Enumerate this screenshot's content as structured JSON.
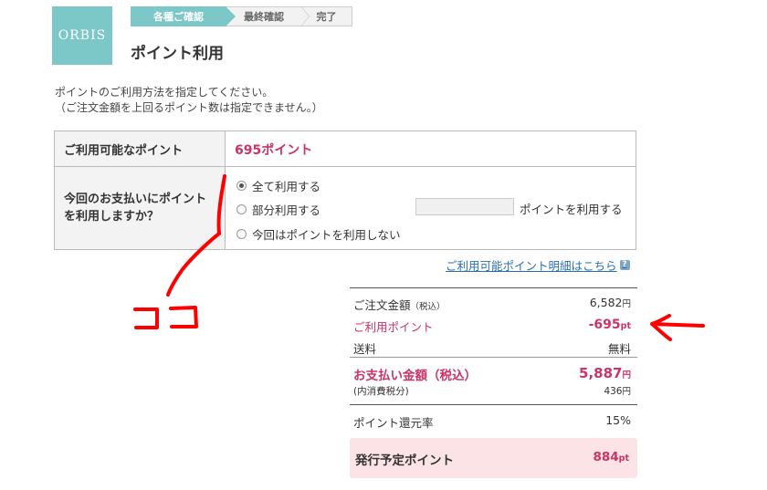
{
  "logo": {
    "text": "ORBIS"
  },
  "steps": [
    "各種ご確認",
    "最終確認",
    "完了"
  ],
  "page_title": "ポイント利用",
  "intro": {
    "line1": "ポイントのご利用方法を指定してください。",
    "line2": "（ご注文金額を上回るポイント数は指定できません。）"
  },
  "points_table": {
    "available_label": "ご利用可能なポイント",
    "available_value": "695ポイント",
    "question_line1": "今回のお支払いにポイント",
    "question_line2": "を利用しますか？",
    "options": [
      "全て利用する",
      "部分利用する",
      "今回はポイントを利用しない"
    ],
    "selected_index": 0,
    "partial_input_value": "",
    "partial_suffix": "ポイントを利用する"
  },
  "detail_link": "ご利用可能ポイント明細はこちら",
  "help_icon": "?",
  "summary": {
    "order_label": "ご注文金額",
    "order_tax": "（税込）",
    "order_value": "6,582",
    "yen": "円",
    "points_used_label": "ご利用ポイント",
    "points_used_value": "-695",
    "pt": "pt",
    "shipping_label": "送料",
    "shipping_value": "無料",
    "payment_label": "お支払い金額（税込）",
    "payment_value": "5,887",
    "tax_label": "(内消費税分)",
    "tax_value": "436",
    "return_rate_label": "ポイント還元率",
    "return_rate_value": "15%",
    "issue_label": "発行予定ポイント",
    "issue_value": "884"
  },
  "annotation": {
    "text": "ココ",
    "color": "#ff0000"
  },
  "colors": {
    "accent": "#7cc7c8",
    "pink": "#cc3366",
    "link": "#2a6fb0",
    "issue_bg": "#fbe3e6"
  }
}
